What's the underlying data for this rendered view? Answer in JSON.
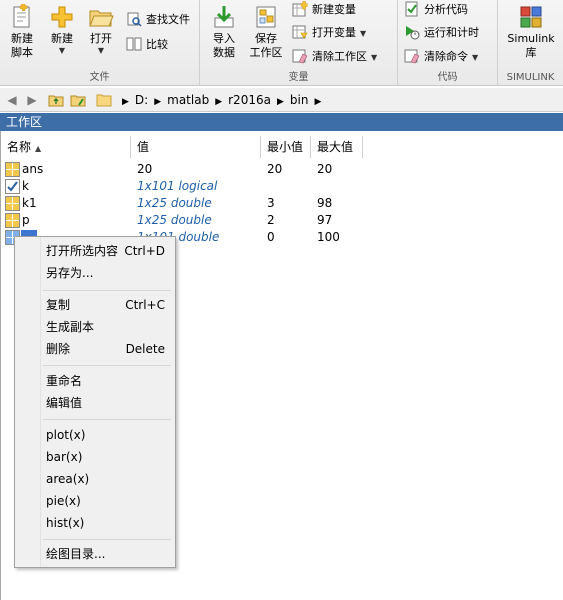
{
  "toolstrip": {
    "file_section": {
      "label": "文件",
      "new_script": [
        "新建",
        "脚本"
      ],
      "new": "新建",
      "open": "打开",
      "find_files": "查找文件",
      "compare": "比较"
    },
    "variable_section": {
      "label": "变量",
      "import_data": [
        "导入",
        "数据"
      ],
      "save_workspace": [
        "保存",
        "工作区"
      ],
      "new_variable": "新建变量",
      "open_variable": "打开变量",
      "clear_workspace": "清除工作区"
    },
    "code_section": {
      "label": "代码",
      "analyze_code": "分析代码",
      "run_and_time": "运行和计时",
      "clear_commands": "清除命令"
    },
    "simulink_section": {
      "label": "SIMULINK",
      "simulink_library": [
        "Simulink",
        "库"
      ]
    }
  },
  "address_bar": {
    "path": [
      "D:",
      "matlab",
      "r2016a",
      "bin"
    ]
  },
  "workspace": {
    "title": "工作区",
    "columns": [
      "名称",
      "值",
      "最小值",
      "最大值"
    ],
    "rows": [
      {
        "name": "ans",
        "value": "20",
        "min": "20",
        "max": "20",
        "italic": false,
        "icon": "numeric-array-icon"
      },
      {
        "name": "k",
        "value": "1x101 logical",
        "min": "",
        "max": "",
        "italic": true,
        "icon": "logical-check-icon"
      },
      {
        "name": "k1",
        "value": "1x25 double",
        "min": "3",
        "max": "98",
        "italic": true,
        "icon": "numeric-array-icon"
      },
      {
        "name": "p",
        "value": "1x25 double",
        "min": "2",
        "max": "97",
        "italic": true,
        "icon": "numeric-array-icon"
      },
      {
        "name": "",
        "value": "1x101 double",
        "min": "0",
        "max": "100",
        "italic": true,
        "icon": "numeric-array-icon"
      }
    ]
  },
  "context_menu": {
    "groups": [
      [
        {
          "label": "打开所选内容",
          "shortcut": "Ctrl+D"
        },
        {
          "label": "另存为...",
          "shortcut": ""
        }
      ],
      [
        {
          "label": "复制",
          "shortcut": "Ctrl+C"
        },
        {
          "label": "生成副本",
          "shortcut": ""
        },
        {
          "label": "删除",
          "shortcut": "Delete"
        }
      ],
      [
        {
          "label": "重命名",
          "shortcut": ""
        },
        {
          "label": "编辑值",
          "shortcut": ""
        }
      ],
      [
        {
          "label": "plot(x)",
          "shortcut": ""
        },
        {
          "label": "bar(x)",
          "shortcut": ""
        },
        {
          "label": "area(x)",
          "shortcut": ""
        },
        {
          "label": "pie(x)",
          "shortcut": ""
        },
        {
          "label": "hist(x)",
          "shortcut": ""
        }
      ],
      [
        {
          "label": "绘图目录...",
          "shortcut": ""
        }
      ]
    ]
  },
  "colors": {
    "title_bar": "#3d6ea8",
    "selection": "#3d76d0",
    "italic_value": "#1f5fa8"
  }
}
